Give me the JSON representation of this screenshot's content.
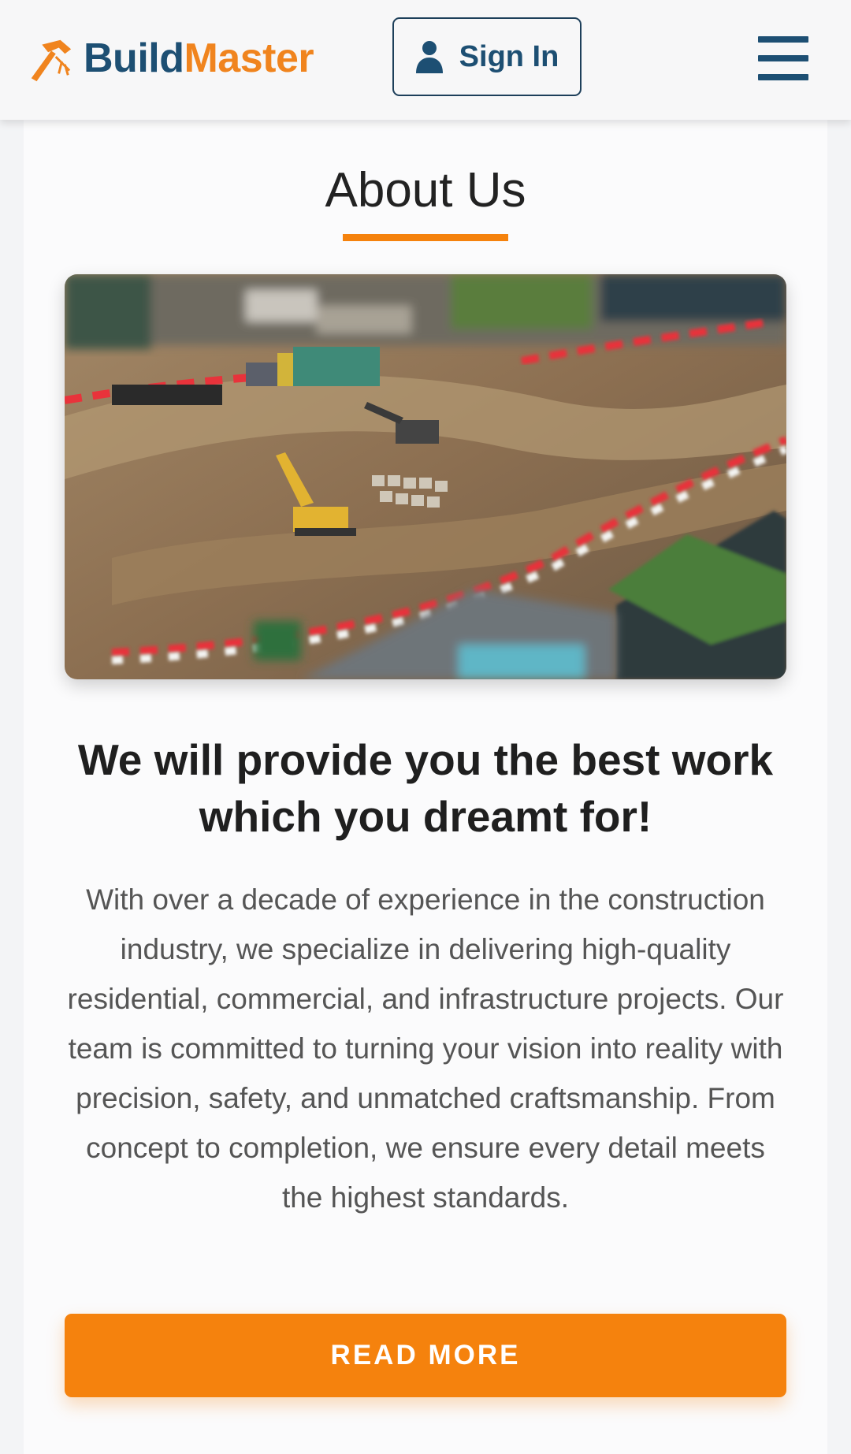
{
  "header": {
    "logo": {
      "part1": "Build",
      "part2": "Master",
      "icon": "hammer-icon"
    },
    "sign_in": {
      "label": "Sign In",
      "icon": "user-icon"
    },
    "menu": {
      "icon": "hamburger-menu-icon"
    }
  },
  "about": {
    "title": "About Us",
    "image": {
      "subject": "aerial-construction-site"
    },
    "tagline": "We will provide you the best work which you dreamt for!",
    "description": "With over a decade of experience in the construction industry, we specialize in delivering high-quality residential, commercial, and infrastructure projects. Our team is committed to turning your vision into reality with precision, safety, and unmatched craftsmanship. From concept to completion, we ensure every detail meets the highest standards.",
    "cta_label": "READ MORE"
  },
  "colors": {
    "brand_blue": "#1d4f73",
    "accent_orange": "#f5820d",
    "text_dark": "#222222",
    "text_body": "#555555"
  }
}
